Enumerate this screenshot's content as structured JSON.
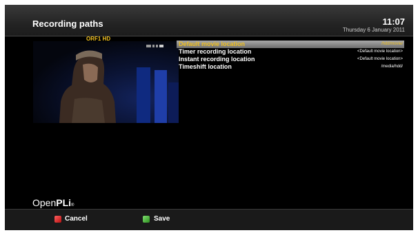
{
  "header": {
    "title": "Recording paths",
    "time": "11:07",
    "date": "Thursday  6 January 2011"
  },
  "preview": {
    "channel": "ORF1 HD"
  },
  "settings": {
    "items": [
      {
        "label": "Default movie location",
        "value": "/hdd/movie/"
      },
      {
        "label": "Timer recording location",
        "value": "<Default movie location>"
      },
      {
        "label": "Instant recording location",
        "value": "<Default movie location>"
      },
      {
        "label": "Timeshift location",
        "value": "/media/hdd/"
      }
    ]
  },
  "branding": {
    "logo_thin": "Open",
    "logo_bold": "PLi",
    "logo_tm": "®"
  },
  "buttons": {
    "cancel": "Cancel",
    "save": "Save"
  },
  "colors": {
    "accent_yellow": "#f0c020",
    "selection_bar": "#8a8a8a",
    "red_key": "#d02020",
    "green_key": "#40b030"
  }
}
